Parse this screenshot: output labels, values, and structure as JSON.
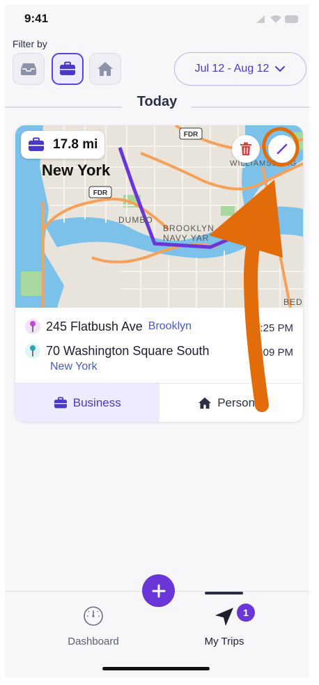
{
  "status_bar": {
    "time": "9:41"
  },
  "filter": {
    "label": "Filter by",
    "buttons": [
      {
        "name": "all",
        "icon": "inbox-icon"
      },
      {
        "name": "business",
        "icon": "briefcase-icon",
        "active": true
      },
      {
        "name": "personal",
        "icon": "home-icon"
      }
    ],
    "date_range": "Jul 12 - Aug 12"
  },
  "section_title": "Today",
  "trip": {
    "distance": "17.8 mi",
    "map_labels": {
      "city": "New York",
      "fdr": "FDR",
      "dumbo": "DUMBO",
      "brooklyn": "BROOKLYN",
      "navy_yard": "NAVY YAR",
      "williamsburg": "WILLIAMSBURG",
      "bed": "BED"
    },
    "start": {
      "address": "245 Flatbush Ave",
      "city": "Brooklyn",
      "time": "12:25 PM"
    },
    "end": {
      "address": "70 Washington Square South",
      "city": "New York",
      "time": "1:09 PM"
    },
    "category_business": "Business",
    "category_personal": "Personal"
  },
  "tabbar": {
    "dashboard": "Dashboard",
    "my_trips": "My Trips",
    "badge": "1"
  },
  "colors": {
    "accent": "#6a36d8",
    "annotation": "#e36c0a"
  }
}
